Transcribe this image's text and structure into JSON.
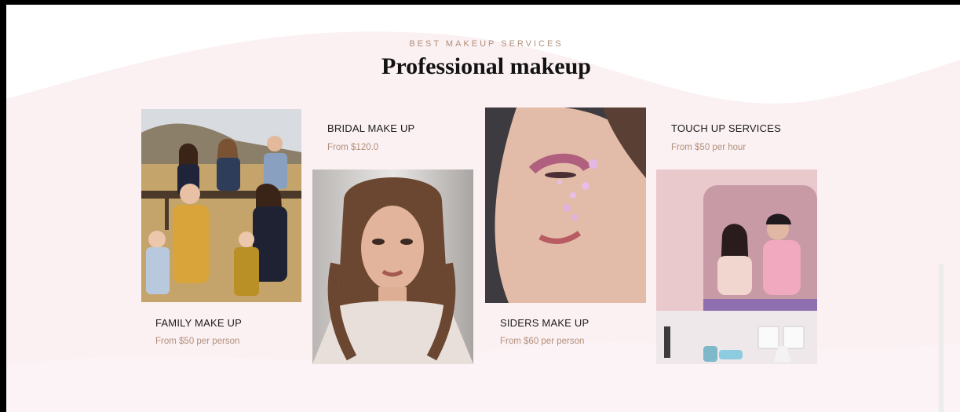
{
  "section": {
    "eyebrow": "BEST MAKEUP SERVICES",
    "title": "Professional makeup"
  },
  "services": [
    {
      "name": "FAMILY MAKE UP",
      "price": "From $50 per person",
      "image": "family-photo"
    },
    {
      "name": "BRIDAL MAKE UP",
      "price": "From $120.0",
      "image": "bride-photo"
    },
    {
      "name": "SIDERS MAKE UP",
      "price": "From $60 per person",
      "image": "floral-face-makeup-photo"
    },
    {
      "name": "TOUCH UP SERVICES",
      "price": "From $50 per hour",
      "image": "makeup-artist-photo"
    }
  ],
  "colors": {
    "accent": "#b2907c",
    "wave_background": "#fbf0f2",
    "heading": "#121212"
  }
}
